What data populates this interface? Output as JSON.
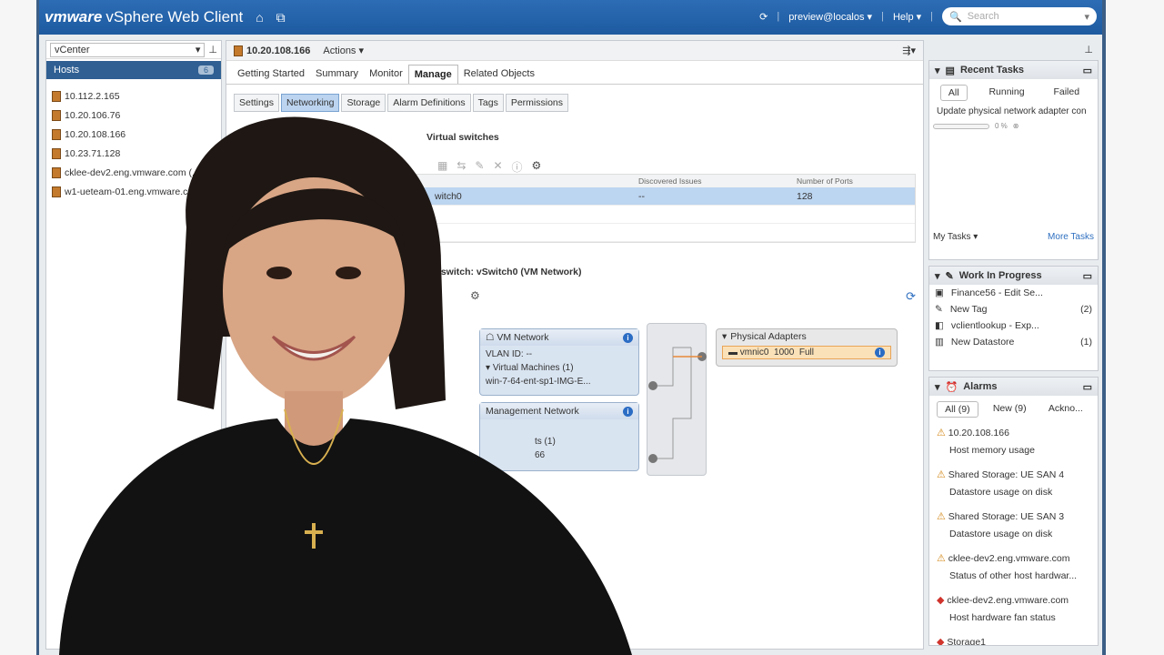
{
  "header": {
    "brand_vm": "vm",
    "brand_ware": "ware",
    "app_title": "vSphere Web Client",
    "user": "preview@localos",
    "help": "Help",
    "search_placeholder": "Search"
  },
  "navigator": {
    "context": "vCenter",
    "section": "Hosts",
    "hosts": [
      "10.112.2.165",
      "10.20.106.76",
      "10.20.108.166",
      "10.23.71.128",
      "cklee-dev2.eng.vmware.com (...",
      "w1-ueteam-01.eng.vmware.com"
    ]
  },
  "main": {
    "host": "10.20.108.166",
    "actions": "Actions",
    "tabs": [
      "Getting Started",
      "Summary",
      "Monitor",
      "Manage",
      "Related Objects"
    ],
    "subtabs": [
      "Settings",
      "Networking",
      "Storage",
      "Alarm Definitions",
      "Tags",
      "Permissions"
    ],
    "virtual_switches_title": "Virtual switches",
    "grid_headers": [
      "Discovered Issues",
      "Number of Ports"
    ],
    "grid_row": {
      "name": "witch0",
      "issues": "--",
      "ports": "128"
    },
    "detail_title": "I switch: vSwitch0 (VM Network)",
    "vm_network": {
      "label": "VM Network",
      "vlan": "VLAN ID: --",
      "vms": "Virtual Machines (1)",
      "vm": "win-7-64-ent-sp1-IMG-E..."
    },
    "management": {
      "label": "Management Network",
      "ports": "ts (1)",
      "ip": "66"
    },
    "physical": {
      "label": "Physical Adapters",
      "nic": "vmnic0",
      "speed": "1000",
      "duplex": "Full"
    }
  },
  "recent_tasks": {
    "title": "Recent Tasks",
    "tabs": [
      "All",
      "Running",
      "Failed"
    ],
    "task": "Update physical network adapter con",
    "progress_text": "0 %",
    "progress": 0,
    "my_tasks": "My Tasks",
    "more_tasks": "More Tasks"
  },
  "wip": {
    "title": "Work In Progress",
    "items": [
      {
        "name": "Finance56 - Edit Se...",
        "count": ""
      },
      {
        "name": "New Tag",
        "count": "(2)"
      },
      {
        "name": "vclientlookup - Exp...",
        "count": ""
      },
      {
        "name": "New Datastore",
        "count": "(1)"
      }
    ]
  },
  "alarms": {
    "title": "Alarms",
    "tabs": [
      "All (9)",
      "New (9)",
      "Ackno..."
    ],
    "items": [
      {
        "target": "10.20.108.166",
        "desc": "Host memory usage",
        "level": "warning"
      },
      {
        "target": "Shared Storage: UE SAN 4",
        "desc": "Datastore usage on disk",
        "level": "warning"
      },
      {
        "target": "Shared Storage: UE SAN 3",
        "desc": "Datastore usage on disk",
        "level": "warning"
      },
      {
        "target": "cklee-dev2.eng.vmware.com",
        "desc": "Status of other host hardwar...",
        "level": "warning"
      },
      {
        "target": "cklee-dev2.eng.vmware.com",
        "desc": "Host hardware fan status",
        "level": "critical"
      },
      {
        "target": "Storage1",
        "desc": "",
        "level": "critical"
      }
    ]
  },
  "colors": {
    "header": "#1d5aa0",
    "accent": "#2f5f93",
    "selection": "#bcd5f0"
  }
}
